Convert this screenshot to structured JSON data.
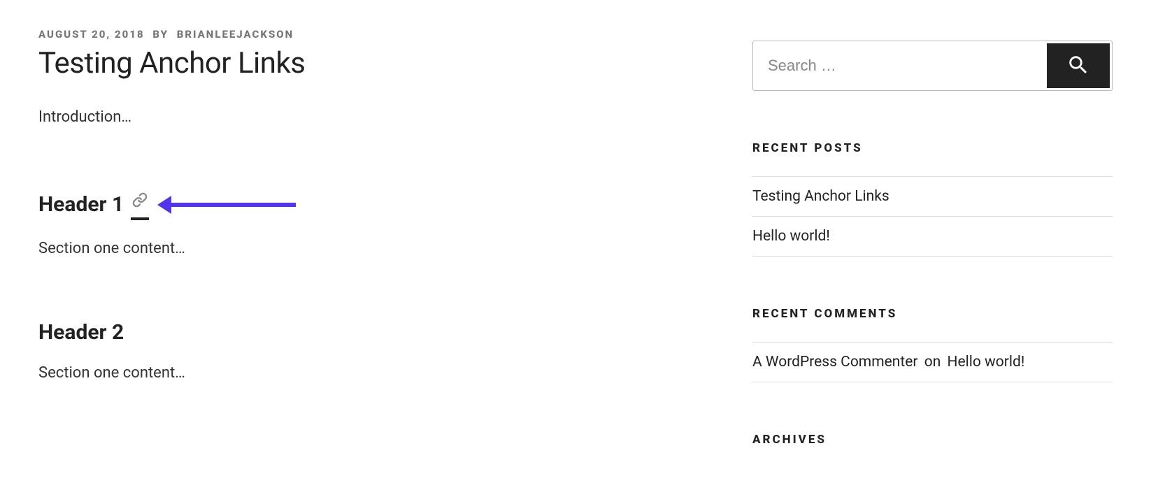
{
  "meta": {
    "date": "AUGUST 20, 2018",
    "by": "BY",
    "author": "BRIANLEEJACKSON"
  },
  "post": {
    "title": "Testing Anchor Links",
    "intro": "Introduction…",
    "header1": "Header 1",
    "section1": "Section one content…",
    "header2": "Header 2",
    "section2": "Section one content…"
  },
  "sidebar": {
    "search_placeholder": "Search …",
    "recent_posts_title": "RECENT POSTS",
    "recent_posts": [
      "Testing Anchor Links",
      "Hello world!"
    ],
    "recent_comments_title": "RECENT COMMENTS",
    "recent_comments": [
      {
        "author": "A WordPress Commenter",
        "on": "on",
        "post": "Hello world!"
      }
    ],
    "archives_title": "ARCHIVES"
  }
}
